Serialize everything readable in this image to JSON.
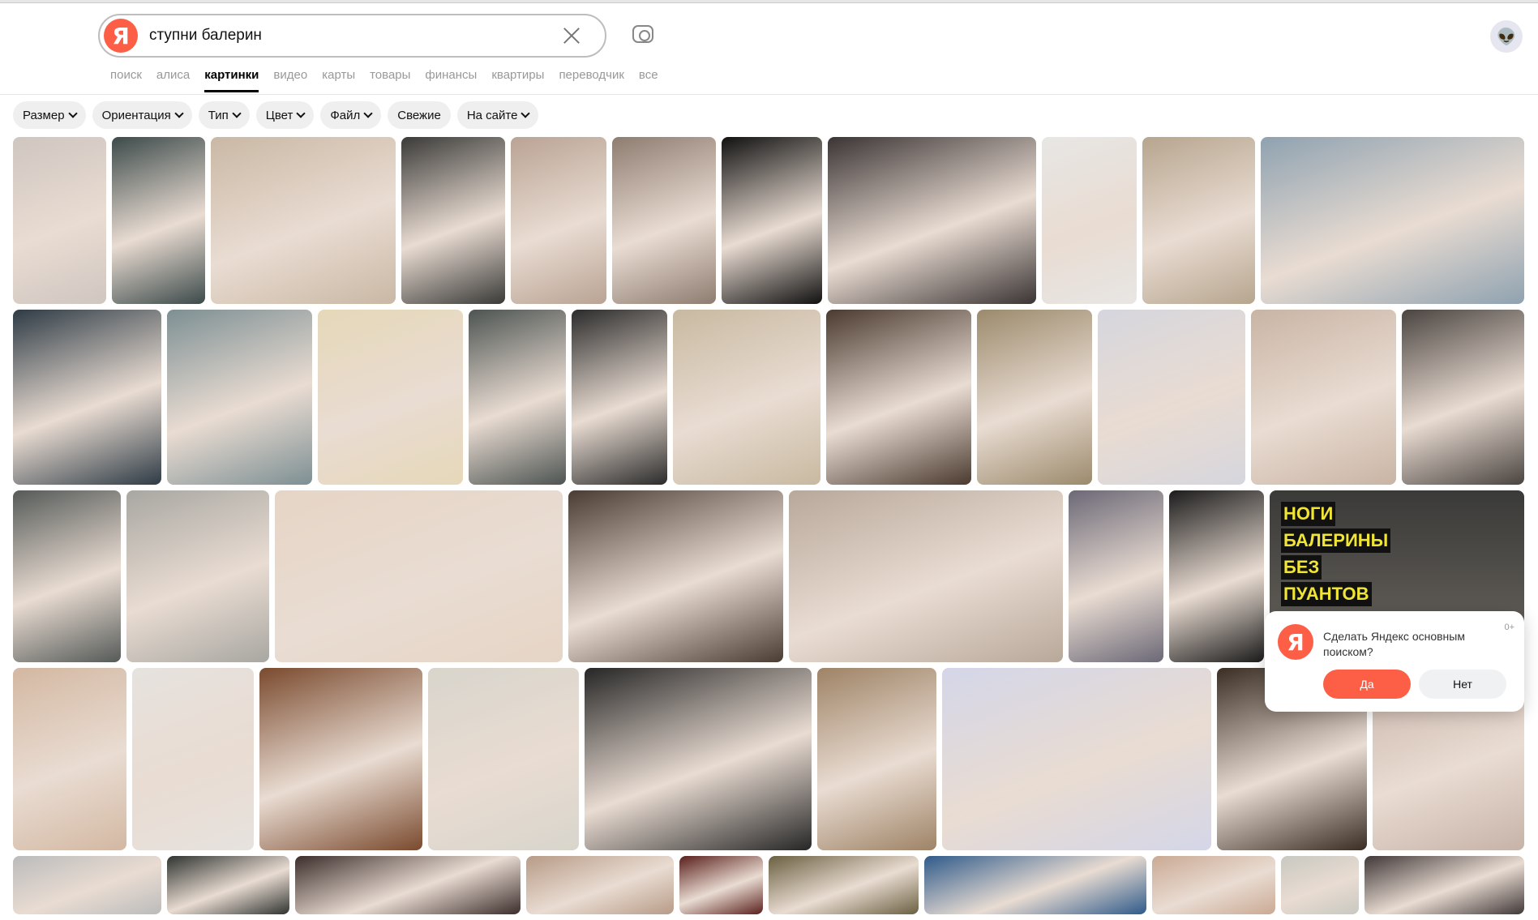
{
  "search": {
    "query": "ступни балерин",
    "logo": "Я"
  },
  "nav_tabs": [
    "поиск",
    "алиса",
    "картинки",
    "видео",
    "карты",
    "товары",
    "финансы",
    "квартиры",
    "переводчик",
    "все"
  ],
  "active_tab": "картинки",
  "filters": [
    {
      "label": "Размер",
      "dropdown": true
    },
    {
      "label": "Ориентация",
      "dropdown": true
    },
    {
      "label": "Тип",
      "dropdown": true
    },
    {
      "label": "Цвет",
      "dropdown": true
    },
    {
      "label": "Файл",
      "dropdown": true
    },
    {
      "label": "Свежие",
      "dropdown": false
    },
    {
      "label": "На сайте",
      "dropdown": true
    }
  ],
  "image_overlay_text": [
    "НОГИ",
    "БАЛЕРИНЫ",
    "БЕЗ",
    "ПУАНТОВ"
  ],
  "popup": {
    "logo": "Я",
    "text": "Сделать Яндекс основным поиском?",
    "age": "0+",
    "yes": "Да",
    "no": "Нет"
  },
  "colors": {
    "brand": "#fc5f45"
  }
}
